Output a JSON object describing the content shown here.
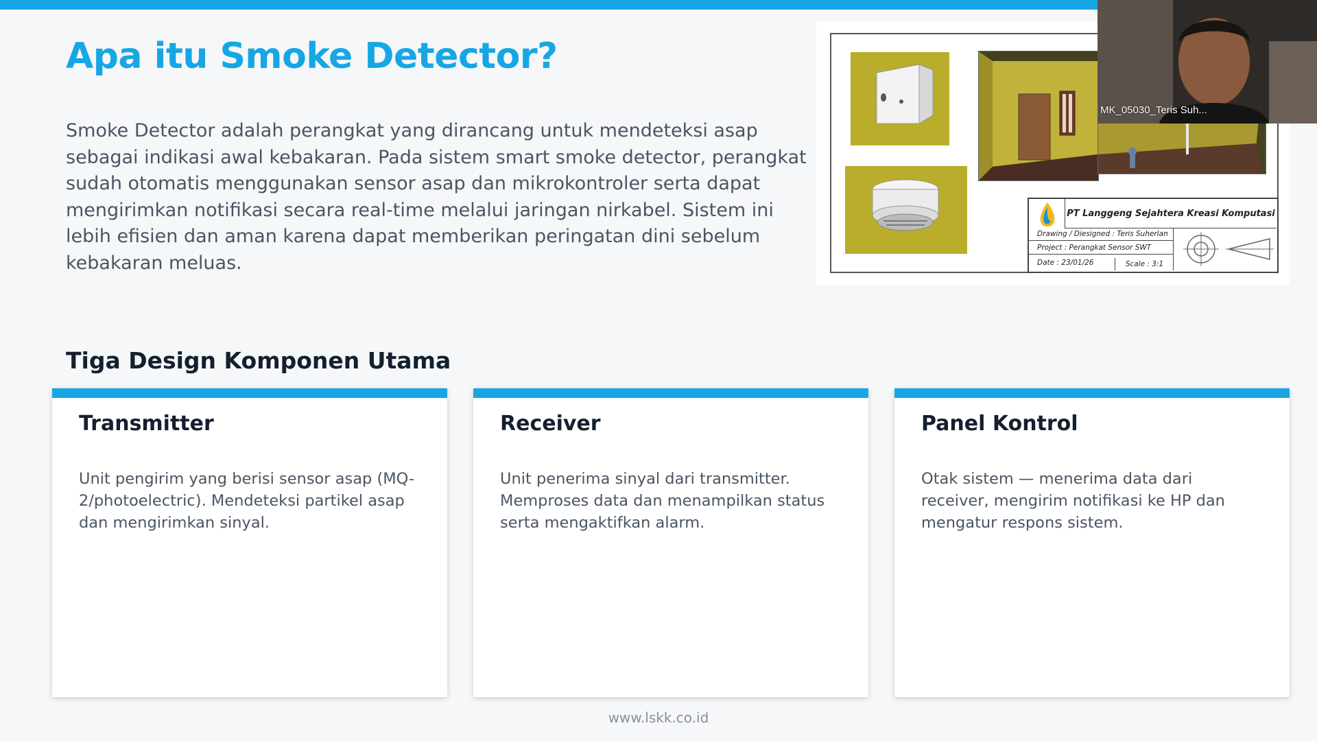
{
  "slide": {
    "title": "Apa itu Smoke Detector?",
    "intro": "Smoke Detector adalah perangkat yang dirancang untuk mendeteksi asap sebagai indikasi awal kebakaran. Pada sistem smart smoke detector, perangkat sudah otomatis menggunakan sensor asap dan mikrokontroler serta dapat mengirimkan notifikasi secara real-time melalui jaringan nirkabel. Sistem ini lebih efisien dan aman karena dapat memberikan peringatan dini sebelum kebakaran meluas.",
    "section_title": "Tiga Design Komponen Utama",
    "footer": "www.lskk.co.id"
  },
  "drawing": {
    "company": "PT Langgeng Sejahtera Kreasi Komputasi",
    "designed": "Drawing / Diesigned : Teris Suherlan",
    "project": "Project : Perangkat Sensor SWT",
    "date": "Date : 23/01/26",
    "scale": "Scale : 3:1"
  },
  "cards": [
    {
      "title": "Transmitter",
      "text": "Unit pengirim yang berisi sensor asap (MQ-2/photoelectric). Mendeteksi partikel asap dan mengirimkan sinyal."
    },
    {
      "title": "Receiver",
      "text": "Unit penerima sinyal dari transmitter. Memproses data dan menampilkan status serta mengaktifkan alarm."
    },
    {
      "title": "Panel Kontrol",
      "text": "Otak sistem — menerima data dari receiver, mengirim notifikasi ke HP dan mengatur respons sistem."
    }
  ],
  "webcam": {
    "participant_name": "MK_05030_Teris Suh..."
  },
  "colors": {
    "accent": "#16a6e4",
    "heading": "#14202e",
    "body_text": "#4a5563",
    "drawing_yellow": "#b8ad2c"
  }
}
